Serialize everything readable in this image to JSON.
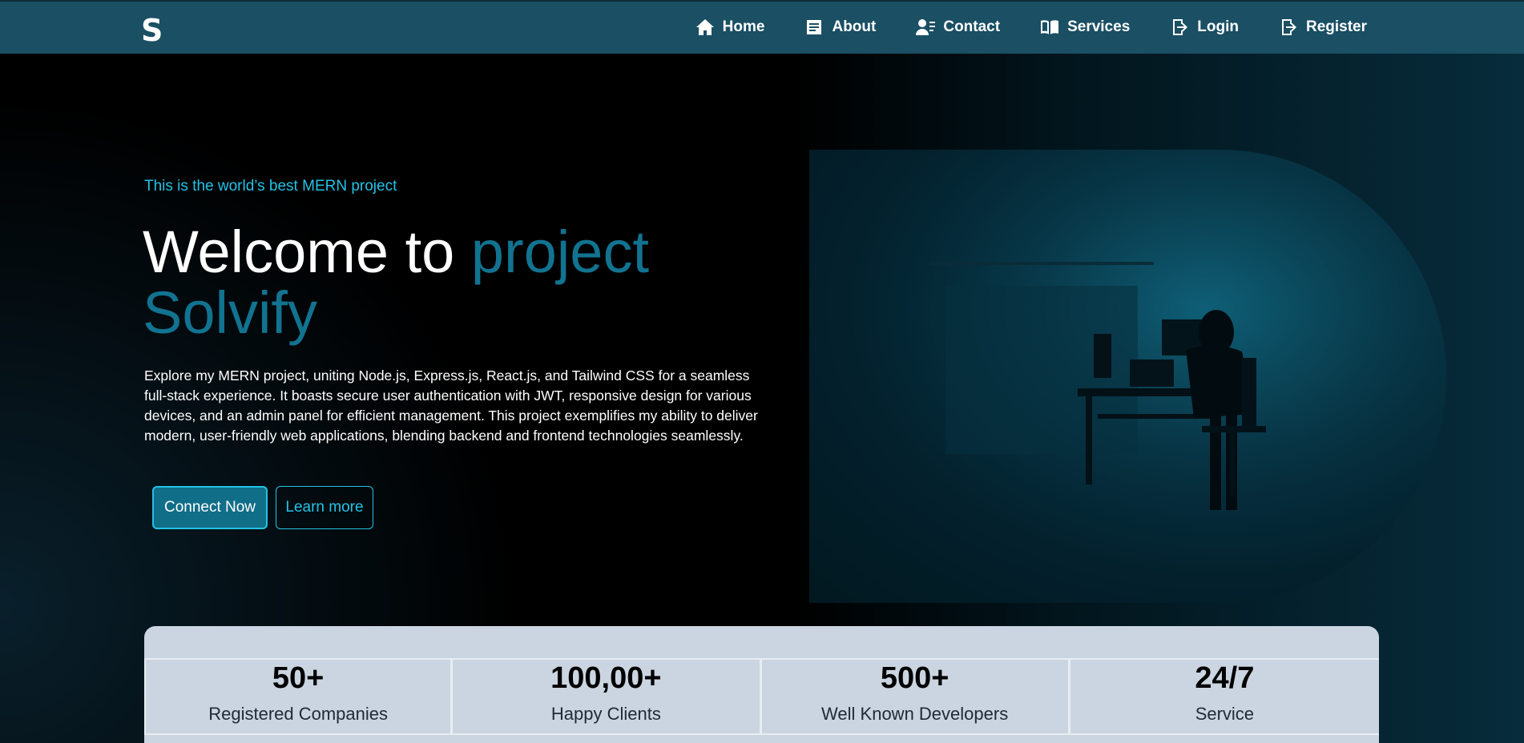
{
  "navbar": {
    "logo": "S",
    "items": [
      {
        "label": "Home",
        "icon": "home-icon"
      },
      {
        "label": "About",
        "icon": "document-icon"
      },
      {
        "label": "Contact",
        "icon": "contact-icon"
      },
      {
        "label": "Services",
        "icon": "book-icon"
      },
      {
        "label": "Login",
        "icon": "login-icon"
      },
      {
        "label": "Register",
        "icon": "register-icon"
      }
    ]
  },
  "hero": {
    "tagline": "This is the world’s best MERN project",
    "headline_plain": "Welcome to ",
    "headline_accent": "project Solvify",
    "description": "Explore my MERN project, uniting Node.js, Express.js, React.js, and Tailwind CSS for a seamless full-stack experience. It boasts secure user authentication with JWT, responsive design for various devices, and an admin panel for efficient management. This project exemplifies my ability to deliver modern, user-friendly web applications, blending backend and frontend technologies seamlessly.",
    "primary_button": "Connect Now",
    "secondary_button": "Learn more",
    "image": "hacker-at-desk-image"
  },
  "stats": [
    {
      "value": "50+",
      "label": "Registered Companies"
    },
    {
      "value": "100,00+",
      "label": "Happy Clients"
    },
    {
      "value": "500+",
      "label": "Well Known Developers"
    },
    {
      "value": "24/7",
      "label": "Service"
    }
  ],
  "colors": {
    "navbar_bg": "#1a4f64",
    "accent": "#22c3e6",
    "headline_accent": "#127391",
    "button_bg": "#116e88",
    "stats_bg": "#cbd5e1"
  }
}
